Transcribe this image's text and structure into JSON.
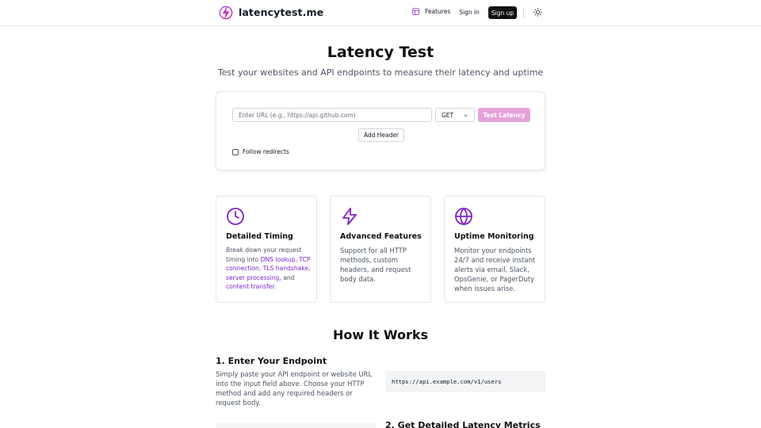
{
  "header": {
    "brand": "latencytest.me",
    "nav": {
      "features": "Features",
      "sign_in": "Sign in",
      "sign_up": "Sign up"
    },
    "icons": {
      "logo": "lightning-bolt-icon",
      "features": "layout-icon",
      "theme": "sun-icon"
    }
  },
  "hero": {
    "title": "Latency Test",
    "subtitle": "Test your websites and API endpoints to measure their latency and uptime"
  },
  "test_form": {
    "url_placeholder": "Enter URL (e.g., https://api.github.com)",
    "url_value": "",
    "method": "GET",
    "test_button": "Test Latency",
    "add_header": "Add Header",
    "follow_redirects": "Follow redirects",
    "follow_redirects_checked": false
  },
  "features": [
    {
      "icon": "clock-icon",
      "title": "Detailed Timing",
      "desc_1": "Break down your request timing into ",
      "link_1": "DNS lookup",
      "sep_1": ", ",
      "link_2": "TCP connection",
      "sep_2": ", ",
      "link_3": "TLS handshake",
      "sep_3": ", ",
      "link_4": "server processing",
      "sep_4": ", and ",
      "link_5": "content transfer",
      "end": "."
    },
    {
      "icon": "zap-icon",
      "title": "Advanced Features",
      "desc": "Support for all HTTP methods, custom headers, and request body data."
    },
    {
      "icon": "globe-icon",
      "title": "Uptime Monitoring",
      "desc": "Monitor your endpoints 24/7 and receive instant alerts via email, Slack, OpsGenie, or PagerDuty when issues arise."
    }
  ],
  "how_it_works": {
    "title": "How It Works",
    "step1_title": "1. Enter Your Endpoint",
    "step1_desc": "Simply paste your API endpoint or website URL into the input field above. Choose your HTTP method and add any required headers or request body.",
    "step1_code": "https://api.example.com/v1/users",
    "step2_title": "2. Get Detailed Latency Metrics"
  },
  "colors": {
    "accent": "#7e22ce",
    "test_button": "#e5a3dc",
    "sign_up_bg": "#111111"
  }
}
